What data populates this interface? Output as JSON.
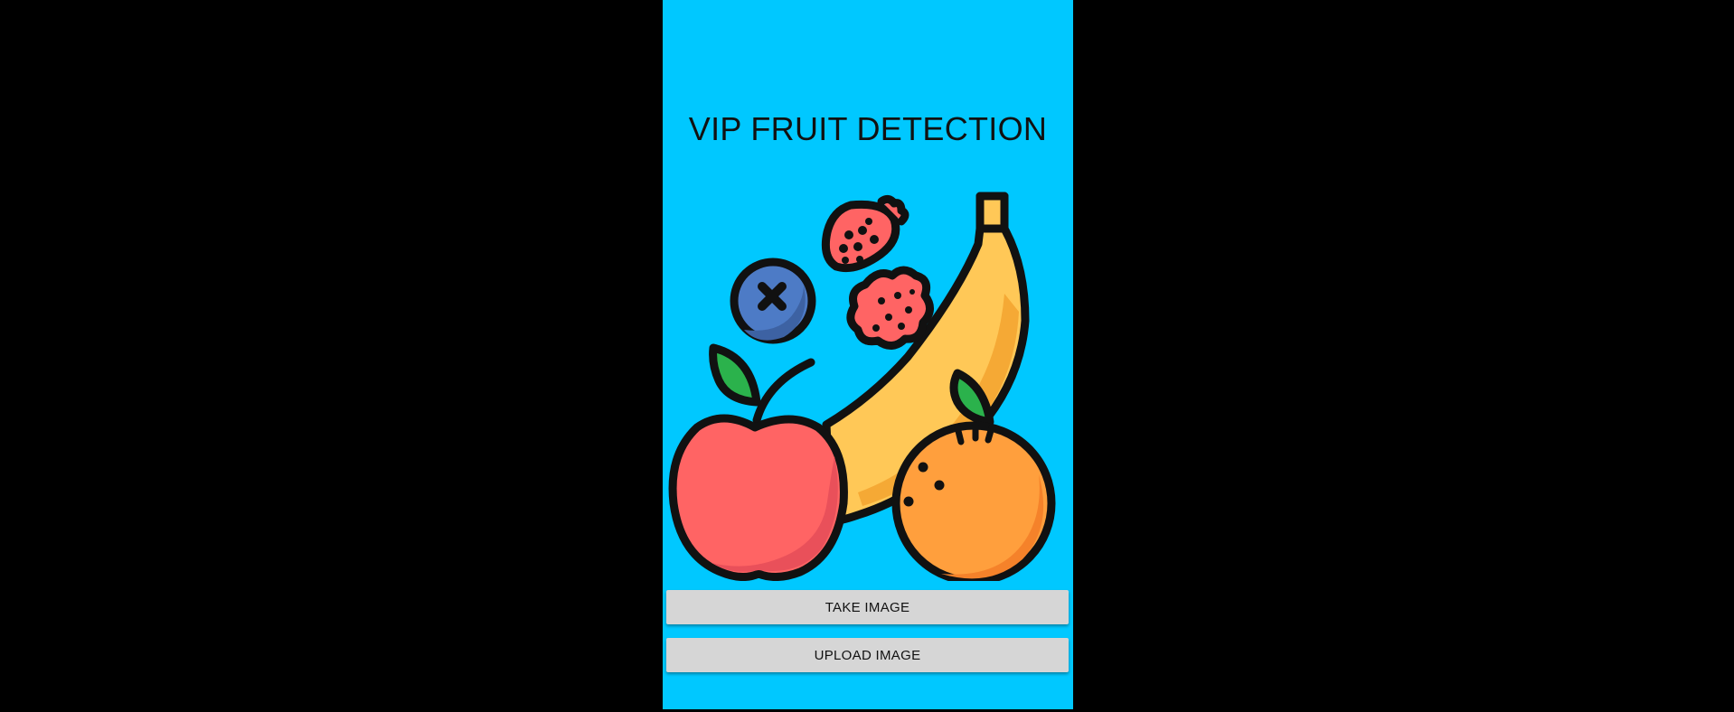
{
  "app": {
    "title": "VIP FRUIT DETECTION",
    "background_color": "#00c8ff",
    "illustration": {
      "icons": [
        "strawberry-icon",
        "blueberry-icon",
        "raspberry-icon",
        "banana-icon",
        "apple-icon",
        "orange-icon"
      ]
    }
  },
  "buttons": {
    "take_image_label": "TAKE IMAGE",
    "upload_image_label": "UPLOAD IMAGE"
  }
}
